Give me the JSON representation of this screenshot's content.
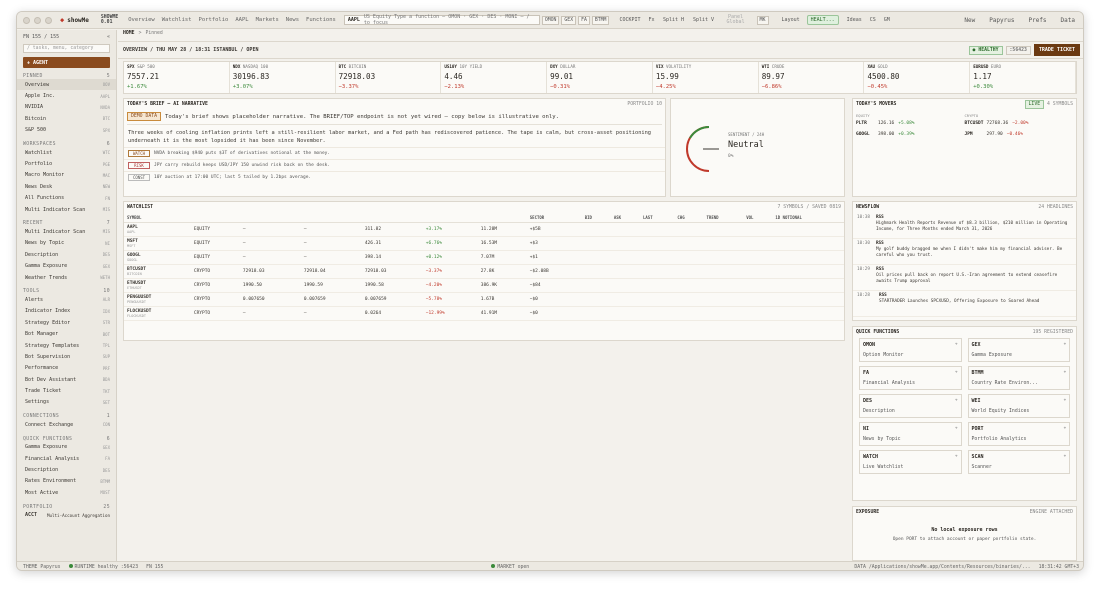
{
  "titlebar": {
    "brand": "showMe",
    "product_line1": "SHOWME",
    "product_line2": "0.01",
    "nav": [
      "Overview",
      "Watchlist",
      "Portfolio",
      "AAPL",
      "Markets",
      "News",
      "Functions"
    ],
    "cmd_ticker": "AAPL",
    "cmd_text": "US Equity  Type a function — OMON · GEX · DES · MONI — / to focus",
    "chips": [
      "OMON",
      "GEX",
      "FA",
      "BTMM"
    ],
    "cockpit": "COCKPIT",
    "fx": "Fx",
    "split_h": "Split H",
    "split_v": "Split V",
    "panel_global": "Panel Global",
    "mk": "MK",
    "layout": "Layout",
    "health": "HEALT...",
    "ideas": "Ideas",
    "ideas_sub": "CS",
    "gm": "GM",
    "right_links": [
      "New",
      "Papyrus",
      "Prefs",
      "Data"
    ]
  },
  "sidebar": {
    "fn_count": "FN 155 / 155",
    "search_placeholder": "/ tasks, menu, category",
    "agent_label": "+ AGENT",
    "sections": [
      {
        "title": "PINNED",
        "count": "5",
        "items": [
          {
            "label": "Overview",
            "key": "OOV",
            "active": true
          },
          {
            "label": "Apple Inc.",
            "key": "AAPL"
          },
          {
            "label": "NVIDIA",
            "key": "NVDA"
          },
          {
            "label": "Bitcoin",
            "key": "BTC"
          },
          {
            "label": "S&P 500",
            "key": "SPX"
          }
        ]
      },
      {
        "title": "WORKSPACES",
        "count": "6",
        "items": [
          {
            "label": "Watchlist",
            "key": "WTC"
          },
          {
            "label": "Portfolio",
            "key": "PGE"
          },
          {
            "label": "Macro Monitor",
            "key": "MAC"
          },
          {
            "label": "News Desk",
            "key": "NEW"
          },
          {
            "label": "All Functions",
            "key": "FN"
          },
          {
            "label": "Multi Indicator Scan",
            "key": "MIS"
          }
        ]
      },
      {
        "title": "RECENT",
        "count": "7",
        "items": [
          {
            "label": "Multi Indicator Scan",
            "key": "MIS"
          },
          {
            "label": "News by Topic",
            "key": "NI"
          },
          {
            "label": "Description",
            "key": "DES"
          },
          {
            "label": "Gamma Exposure",
            "key": "GEX"
          },
          {
            "label": "Weather Trends",
            "key": "WETH"
          }
        ]
      },
      {
        "title": "TOOLS",
        "count": "10",
        "items": [
          {
            "label": "Alerts",
            "key": "ALR"
          },
          {
            "label": "Indicator Index",
            "key": "IDX"
          },
          {
            "label": "Strategy Editor",
            "key": "STR"
          },
          {
            "label": "Bot Manager",
            "key": "BOT"
          },
          {
            "label": "Strategy Templates",
            "key": "TPL"
          },
          {
            "label": "Bot Supervision",
            "key": "SUP"
          },
          {
            "label": "Performance",
            "key": "PRF"
          },
          {
            "label": "Bot Dev Assistant",
            "key": "BDA"
          },
          {
            "label": "Trade Ticket",
            "key": "TKT"
          },
          {
            "label": "Settings",
            "key": "SET"
          }
        ]
      },
      {
        "title": "CONNECTIONS",
        "count": "1",
        "items": [
          {
            "label": "Connect Exchange",
            "key": "CON"
          }
        ]
      },
      {
        "title": "QUICK FUNCTIONS",
        "count": "6",
        "items": [
          {
            "label": "Gamma Exposure",
            "key": "GEX"
          },
          {
            "label": "Financial Analysis",
            "key": "FA"
          },
          {
            "label": "Description",
            "key": "DES"
          },
          {
            "label": "Rates Environment",
            "key": "BTMM"
          },
          {
            "label": "Most Active",
            "key": "MOST"
          }
        ]
      },
      {
        "title": "PORTFOLIO",
        "count": "25",
        "items": []
      }
    ],
    "acct_label": "ACCT",
    "acct_value": "Multi-Account Aggregation"
  },
  "breadcrumb": {
    "home": "HOME",
    "sep": ">",
    "page": "Pinned"
  },
  "header": {
    "title": "OVERVIEW / THU MAY 28 / 18:31 ISTANBUL / OPEN",
    "healthy": "● HEALTHY",
    "port": ":56423",
    "trade_ticket": "TRADE TICKET"
  },
  "quotes": [
    {
      "sym": "SPX",
      "name": "S&P 500",
      "px": "7557.21",
      "ch": "+1.67%",
      "dir": "up"
    },
    {
      "sym": "NDX",
      "name": "NASDAQ 100",
      "px": "30196.83",
      "ch": "+3.07%",
      "dir": "up"
    },
    {
      "sym": "BTC",
      "name": "BITCOIN",
      "px": "72918.03",
      "ch": "−3.37%",
      "dir": "dn"
    },
    {
      "sym": "US10Y",
      "name": "10Y YIELD",
      "px": "4.46",
      "ch": "−2.13%",
      "dir": "dn"
    },
    {
      "sym": "DXY",
      "name": "DOLLAR",
      "px": "99.01",
      "ch": "−0.31%",
      "dir": "dn"
    },
    {
      "sym": "VIX",
      "name": "VOLATILITY",
      "px": "15.99",
      "ch": "−4.25%",
      "dir": "dn"
    },
    {
      "sym": "WTI",
      "name": "CRUDE",
      "px": "89.97",
      "ch": "−6.86%",
      "dir": "dn"
    },
    {
      "sym": "XAU",
      "name": "GOLD",
      "px": "4500.80",
      "ch": "−0.45%",
      "dir": "dn"
    },
    {
      "sym": "EURUSD",
      "name": "EURO",
      "px": "1.17",
      "ch": "+0.30%",
      "dir": "up"
    }
  ],
  "brief": {
    "title": "TODAY'S BRIEF — AI NARRATIVE",
    "meta": "PORTFOLIO 10",
    "demo_tag": "DEMO DATA",
    "demo_text": "Today's brief shows placeholder narrative. The BRIEF/TOP endpoint is not yet wired — copy below is illustrative only.",
    "narrative": "Three weeks of cooling inflation prints left a still-resilient labor market, and a Fed path has rediscovered patience. The tape is calm, but cross-asset positioning underneath it is the most lopsided it has been since November.",
    "bullets": [
      {
        "tag": "WATCH",
        "cls": "w",
        "text": "NVDA breaking $940 puts $3T of derivatives notional at the money."
      },
      {
        "tag": "RISK",
        "cls": "r",
        "text": "JPY carry rebuild keeps USD/JPY 150 unwind risk back on the desk."
      },
      {
        "tag": "CONST",
        "cls": "",
        "text": "10Y auction at 17:00 UTC; last 5 tailed by 1.2bps average."
      }
    ]
  },
  "sentiment": {
    "label": "SENTIMENT / 24H",
    "value": "Neutral",
    "pct": "0%"
  },
  "movers": {
    "title": "TODAY'S MOVERS",
    "live": "LIVE",
    "meta": "4 SYMBOLS",
    "left_head": "EQUITY",
    "right_head": "CRYPTO",
    "left": [
      {
        "sym": "PLTR",
        "px": "126.16",
        "ch": "+5.08%",
        "dir": "up"
      },
      {
        "sym": "GOOGL",
        "px": "398.00",
        "ch": "+0.39%",
        "dir": "up"
      }
    ],
    "right": [
      {
        "sym": "BTCUSDT",
        "px": "72768.36",
        "ch": "−2.00%",
        "dir": "dn"
      },
      {
        "sym": "JPM",
        "px": "297.90",
        "ch": "−0.46%",
        "dir": "dn"
      }
    ]
  },
  "watchlist": {
    "title": "WATCHLIST",
    "meta": "7 SYMBOLS / SAVED 0819",
    "columns": [
      "SYMBOL",
      "",
      "",
      "",
      "",
      "",
      "",
      "SECTOR",
      "BID",
      "ASK",
      "LAST",
      "CHG",
      "TREND",
      "VOL",
      "1D NOTIONAL"
    ],
    "rows": [
      {
        "sym": "AAPL",
        "sub": "AAPL",
        "type": "EQUITY",
        "bid": "—",
        "ask": "—",
        "last": "311.82",
        "chg": "+3.17%",
        "dir": "up",
        "vol": "11.28M",
        "n": "+$5B"
      },
      {
        "sym": "MSFT",
        "sub": "MSFT",
        "type": "EQUITY",
        "bid": "—",
        "ask": "—",
        "last": "426.31",
        "chg": "+6.76%",
        "dir": "up",
        "vol": "16.53M",
        "n": "+$3"
      },
      {
        "sym": "GOOGL",
        "sub": "GOOGL",
        "type": "EQUITY",
        "bid": "—",
        "ask": "—",
        "last": "398.14",
        "chg": "+0.12%",
        "dir": "up",
        "vol": "7.07M",
        "n": "+$1"
      },
      {
        "sym": "BTCUSDT",
        "sub": "BITCOIN",
        "type": "CRYPTO",
        "bid": "72918.03",
        "ask": "72918.04",
        "last": "72918.03",
        "chg": "−3.37%",
        "dir": "dn",
        "vol": "27.8K",
        "n": "−$2.08B"
      },
      {
        "sym": "ETHUSDT",
        "sub": "ETHUSDT",
        "type": "CRYPTO",
        "bid": "1990.50",
        "ask": "1990.59",
        "last": "1990.58",
        "chg": "−4.20%",
        "dir": "dn",
        "vol": "386.9K",
        "n": "−$84"
      },
      {
        "sym": "PENGUUSDT",
        "sub": "PENGUUSDT",
        "type": "CRYPTO",
        "bid": "0.007650",
        "ask": "0.007659",
        "last": "0.007659",
        "chg": "−5.78%",
        "dir": "dn",
        "vol": "1.67B",
        "n": "−$0"
      },
      {
        "sym": "FLOCKUSDT",
        "sub": "FLOCKUSDT",
        "type": "CRYPTO",
        "bid": "—",
        "ask": "—",
        "last": "0.0264",
        "chg": "−12.99%",
        "dir": "dn",
        "vol": "41.91M",
        "n": "−$0"
      }
    ]
  },
  "newsflow": {
    "title": "NEWSFLOW",
    "meta": "24 HEADLINES",
    "items": [
      {
        "time": "10:38",
        "src": "RSS",
        "text": "Highmark Health Reports Revenue of $8.3 billion, $210 million in Operating Income, for Three Months ended March 31, 2026"
      },
      {
        "time": "10:30",
        "src": "RSS",
        "text": "My golf buddy bragged me when I didn't make him my financial adviser. Be careful who you trust."
      },
      {
        "time": "10:29",
        "src": "RSS",
        "text": "Oil prices pull back on report U.S.-Iran agreement to extend ceasefire awaits Trump approval"
      },
      {
        "time": "10:28",
        "src": "RSS",
        "text": "STARTRADER Launches SPCXUSD, Offering Exposure to Soared Ahead"
      }
    ]
  },
  "quickfn": {
    "title": "QUICK FUNCTIONS",
    "meta": "195 REGISTERED",
    "items": [
      {
        "code": "OMON",
        "desc": "Option Monitor"
      },
      {
        "code": "GEX",
        "desc": "Gamma Exposure"
      },
      {
        "code": "FA",
        "desc": "Financial Analysis"
      },
      {
        "code": "BTMM",
        "desc": "Country Rate Environ..."
      },
      {
        "code": "DES",
        "desc": "Description"
      },
      {
        "code": "WEI",
        "desc": "World Equity Indices"
      },
      {
        "code": "NI",
        "desc": "News by Topic"
      },
      {
        "code": "PORT",
        "desc": "Portfolio Analytics"
      },
      {
        "code": "WATCH",
        "desc": "Live Watchlist"
      },
      {
        "code": "SCAN",
        "desc": "Scanner"
      }
    ]
  },
  "exposure": {
    "title": "EXPOSURE",
    "meta": "ENGINE ATTACHED",
    "empty": "No local exposure rows",
    "hint": "Open PORT to attach account or paper portfolio state."
  },
  "status": {
    "left": "THEME Papyrus",
    "runtime": "RUNTIME healthy :56423",
    "fn": "FN 155",
    "market": "MARKET open",
    "data": "DATA /Applications/showMe.app/Contents/Resources/binaries/...",
    "clock": "18:31:42 GMT+3"
  },
  "colors": {
    "accent": "#8a4b1e",
    "up": "#3b8a3b",
    "down": "#c0392b",
    "bg": "#f3f1ec"
  }
}
